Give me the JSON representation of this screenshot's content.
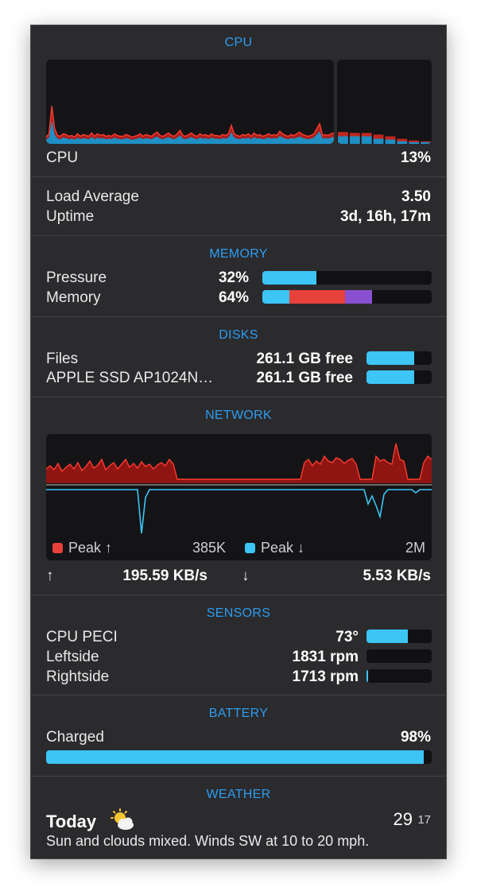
{
  "colors": {
    "accent": "#2d9cf0",
    "bar_blue": "#3cc5f5",
    "red": "#e8403b",
    "purple": "#8a4fd0",
    "panel": "#2b2b2e"
  },
  "cpu": {
    "header": "CPU",
    "label": "CPU",
    "value": "13%",
    "history": [
      8,
      12,
      45,
      18,
      10,
      9,
      12,
      11,
      9,
      10,
      8,
      12,
      9,
      11,
      10,
      9,
      13,
      9,
      12,
      10,
      11,
      9,
      10,
      9,
      12,
      10,
      9,
      9,
      11,
      10,
      8,
      9,
      10,
      12,
      9,
      11,
      10,
      9,
      12,
      14,
      10,
      9,
      11,
      13,
      10,
      9,
      12,
      16,
      10,
      9,
      11,
      13,
      10,
      9,
      12,
      10,
      11,
      9,
      12,
      10,
      10,
      9,
      11,
      10,
      12,
      22,
      12,
      10,
      9,
      11,
      10,
      12,
      9,
      13,
      10,
      11,
      9,
      10,
      12,
      10,
      11,
      10,
      15,
      12,
      10,
      9,
      11,
      10,
      12,
      14,
      11,
      10,
      9,
      10,
      12,
      18,
      24,
      10,
      11,
      10,
      12,
      13
    ],
    "cores": [
      {
        "user": 14,
        "sys": 9
      },
      {
        "user": 13,
        "sys": 9
      },
      {
        "user": 13,
        "sys": 9
      },
      {
        "user": 11,
        "sys": 6
      },
      {
        "user": 9,
        "sys": 5
      },
      {
        "user": 6,
        "sys": 3
      },
      {
        "user": 4,
        "sys": 2
      },
      {
        "user": 3,
        "sys": 2
      }
    ]
  },
  "load": {
    "load_label": "Load Average",
    "load_value": "3.50",
    "uptime_label": "Uptime",
    "uptime_value": "3d, 16h, 17m"
  },
  "memory": {
    "header": "MEMORY",
    "pressure_label": "Pressure",
    "pressure_value": "32%",
    "pressure_fraction": 0.32,
    "memory_label": "Memory",
    "memory_value": "64%",
    "segments": [
      {
        "color": "#3cc5f5",
        "fraction": 0.16
      },
      {
        "color": "#e8403b",
        "fraction": 0.33
      },
      {
        "color": "#8a4fd0",
        "fraction": 0.16
      }
    ]
  },
  "disks": {
    "header": "DISKS",
    "items": [
      {
        "label": "Files",
        "value": "261.1 GB free",
        "fraction": 0.73
      },
      {
        "label": "APPLE SSD AP1024N…",
        "value": "261.1 GB free",
        "fraction": 0.73
      }
    ]
  },
  "network": {
    "header": "NETWORK",
    "upload_history": [
      18,
      22,
      17,
      25,
      15,
      20,
      24,
      18,
      26,
      16,
      21,
      28,
      19,
      23,
      30,
      17,
      22,
      26,
      18,
      24,
      30,
      20,
      25,
      19,
      27,
      21,
      24,
      18,
      23,
      26,
      22,
      30,
      24,
      5,
      5,
      5,
      5,
      5,
      5,
      5,
      5,
      5,
      5,
      5,
      5,
      5,
      5,
      5,
      5,
      5,
      5,
      5,
      5,
      5,
      5,
      5,
      5,
      5,
      5,
      5,
      5,
      5,
      5,
      5,
      5,
      26,
      30,
      22,
      28,
      24,
      34,
      28,
      26,
      32,
      30,
      25,
      29,
      31,
      24,
      5,
      5,
      5,
      5,
      34,
      28,
      30,
      26,
      24,
      50,
      30,
      28,
      5,
      5,
      5,
      5,
      26,
      34,
      30
    ],
    "download_history": [
      0,
      0,
      0,
      0,
      0,
      0,
      0,
      0,
      0,
      0,
      0,
      0,
      0,
      0,
      0,
      0,
      0,
      0,
      0,
      0,
      0,
      0,
      0,
      0,
      55,
      10,
      0,
      0,
      0,
      0,
      0,
      0,
      0,
      0,
      0,
      0,
      0,
      0,
      0,
      0,
      0,
      0,
      0,
      0,
      0,
      0,
      0,
      0,
      0,
      0,
      0,
      0,
      0,
      0,
      0,
      0,
      0,
      0,
      0,
      0,
      0,
      0,
      0,
      0,
      0,
      0,
      0,
      0,
      0,
      0,
      0,
      0,
      0,
      0,
      0,
      0,
      0,
      0,
      0,
      0,
      0,
      18,
      8,
      20,
      34,
      6,
      0,
      0,
      0,
      0,
      0,
      0,
      0,
      4,
      0,
      0,
      0,
      0
    ],
    "legend_up": "Peak ↑",
    "legend_up_value": "385K",
    "legend_down": "Peak ↓",
    "legend_down_value": "2M",
    "up_arrow": "↑",
    "up_rate": "195.59 KB/s",
    "down_arrow": "↓",
    "down_rate": "5.53 KB/s"
  },
  "sensors": {
    "header": "SENSORS",
    "items": [
      {
        "label": "CPU PECI",
        "value": "73°",
        "fraction": 0.63
      },
      {
        "label": "Leftside",
        "value": "1831 rpm",
        "fraction": 0.0
      },
      {
        "label": "Rightside",
        "value": "1713 rpm",
        "fraction": 0.02
      }
    ]
  },
  "battery": {
    "header": "BATTERY",
    "label": "Charged",
    "value": "98%",
    "fraction": 0.98
  },
  "weather": {
    "header": "WEATHER",
    "day": "Today",
    "icon": "sun-cloud-icon",
    "high": "29",
    "low": "17",
    "summary": "Sun and clouds mixed. Winds SW at 10 to 20 mph."
  }
}
